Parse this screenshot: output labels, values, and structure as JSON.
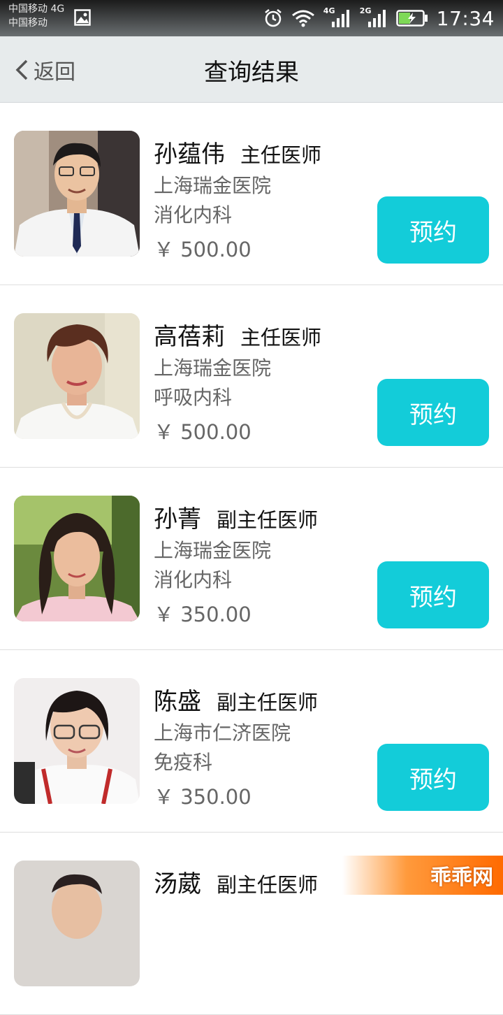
{
  "status_bar": {
    "carrier_1": "中国移动 4G",
    "carrier_2": "中国移动",
    "net_1": "4G",
    "net_2": "2G",
    "time": "17:34"
  },
  "header": {
    "back_label": "返回",
    "title": "查询结果"
  },
  "doctors": [
    {
      "name": "孙蕴伟",
      "rank": "主任医师",
      "hospital": "上海瑞金医院",
      "department": "消化内科",
      "price": "￥ 500.00",
      "book_label": "预约"
    },
    {
      "name": "高蓓莉",
      "rank": "主任医师",
      "hospital": "上海瑞金医院",
      "department": "呼吸内科",
      "price": "￥ 500.00",
      "book_label": "预约"
    },
    {
      "name": "孙菁",
      "rank": "副主任医师",
      "hospital": "上海瑞金医院",
      "department": "消化内科",
      "price": "￥ 350.00",
      "book_label": "预约"
    },
    {
      "name": "陈盛",
      "rank": "副主任医师",
      "hospital": "上海市仁济医院",
      "department": "免疫科",
      "price": "￥ 350.00",
      "book_label": "预约"
    },
    {
      "name": "汤葳",
      "rank": "副主任医师"
    }
  ],
  "watermark": "乖乖网",
  "colors": {
    "accent": "#13ccd9",
    "header_bg": "#e7ebec"
  }
}
